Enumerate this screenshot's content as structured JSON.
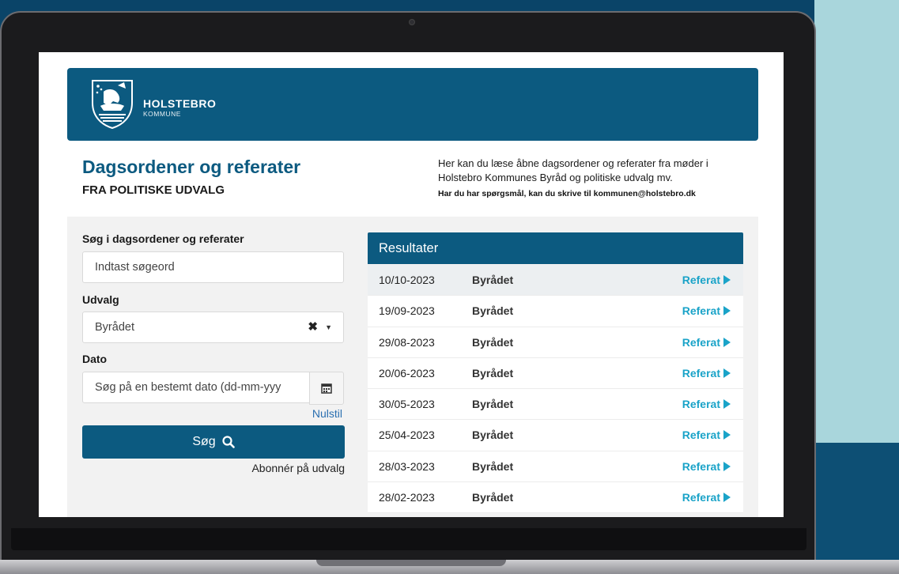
{
  "brand": {
    "name": "HOLSTEBRO",
    "sub": "KOMMUNE"
  },
  "page": {
    "title": "Dagsordener og referater",
    "subtitle": "FRA POLITISKE UDVALG",
    "intro": "Her kan du læse åbne dagsordener og referater fra møder i Holstebro Kommunes Byråd og politiske udvalg mv.",
    "contact": "Har du har spørgsmål, kan du skrive til kommunen@holstebro.dk"
  },
  "search": {
    "label": "Søg i dagsordener og referater",
    "placeholder": "Indtast søgeord",
    "committee_label": "Udvalg",
    "committee_value": "Byrådet",
    "date_label": "Dato",
    "date_placeholder": "Søg på en bestemt dato (dd-mm-yyy",
    "reset": "Nulstil",
    "button": "Søg",
    "subscribe": "Abonnér på udvalg"
  },
  "results": {
    "header": "Resultater",
    "rows": [
      {
        "date": "10/10-2023",
        "org": "Byrådet",
        "link": "Referat"
      },
      {
        "date": "19/09-2023",
        "org": "Byrådet",
        "link": "Referat"
      },
      {
        "date": "29/08-2023",
        "org": "Byrådet",
        "link": "Referat"
      },
      {
        "date": "20/06-2023",
        "org": "Byrådet",
        "link": "Referat"
      },
      {
        "date": "30/05-2023",
        "org": "Byrådet",
        "link": "Referat"
      },
      {
        "date": "25/04-2023",
        "org": "Byrådet",
        "link": "Referat"
      },
      {
        "date": "28/03-2023",
        "org": "Byrådet",
        "link": "Referat"
      },
      {
        "date": "28/02-2023",
        "org": "Byrådet",
        "link": "Referat"
      }
    ]
  },
  "colors": {
    "primary": "#0c5a80",
    "link": "#1aa3c8",
    "panel": "#f2f2f2"
  }
}
